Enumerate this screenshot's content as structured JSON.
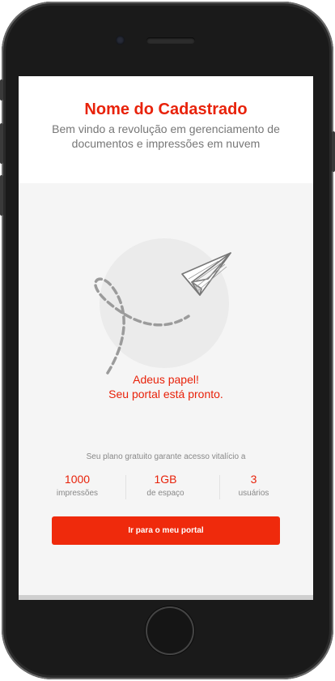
{
  "header": {
    "title": "Nome do Cadastrado",
    "subtitle": "Bem vindo a revolução em gerenciamento de documentos e impressões em nuvem"
  },
  "hero": {
    "icon": "paper-plane-icon",
    "message_line1": "Adeus papel!",
    "message_line2": "Seu portal está pronto."
  },
  "plan": {
    "text": "Seu plano gratuito garante acesso vitalício a",
    "stats": [
      {
        "value": "1000",
        "label": "impressões"
      },
      {
        "value": "1GB",
        "label": "de espaço"
      },
      {
        "value": "3",
        "label": "usuários"
      }
    ]
  },
  "cta": {
    "label": "Ir para o meu portal"
  },
  "colors": {
    "accent": "#e8220a",
    "button": "#ef2a0c",
    "background": "#f5f5f5",
    "muted_text": "#888888"
  }
}
